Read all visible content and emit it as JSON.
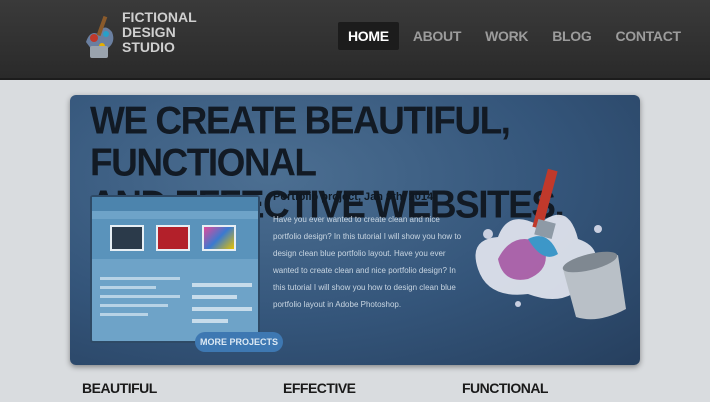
{
  "brand": {
    "lines": [
      "FICTIONAL",
      "DESIGN",
      "STUDIO"
    ]
  },
  "nav": {
    "items": [
      {
        "label": "HOME",
        "active": true
      },
      {
        "label": "ABOUT",
        "active": false
      },
      {
        "label": "WORK",
        "active": false
      },
      {
        "label": "BLOG",
        "active": false
      },
      {
        "label": "CONTACT",
        "active": false
      }
    ]
  },
  "hero": {
    "title_line1": "WE CREATE BEAUTIFUL, FUNCTIONAL",
    "title_line2": "AND EFFECTIVE WEBSITES.",
    "post_title": "Portfolio project, Jan 9th, 2014",
    "post_body": "Have you ever wanted to create clean and nice portfolio design? In this tutorial I will show you how to design clean blue portfolio layout. Have you ever wanted to create clean and nice portfolio design? In this tutorial I will show you how to design clean blue portfolio layout in Adobe Photoshop.",
    "more_button": "MORE PROJECTS"
  },
  "columns": [
    "BEAUTIFUL",
    "EFFECTIVE",
    "FUNCTIONAL"
  ],
  "colors": {
    "header": "#2f2f2f",
    "hero": "#34557a",
    "accent": "#3e78b2",
    "page": "#d9dcdf"
  },
  "icons": {
    "logo": "paint-splash-logo-icon",
    "illustration": "paint-bucket-brush-icon"
  }
}
